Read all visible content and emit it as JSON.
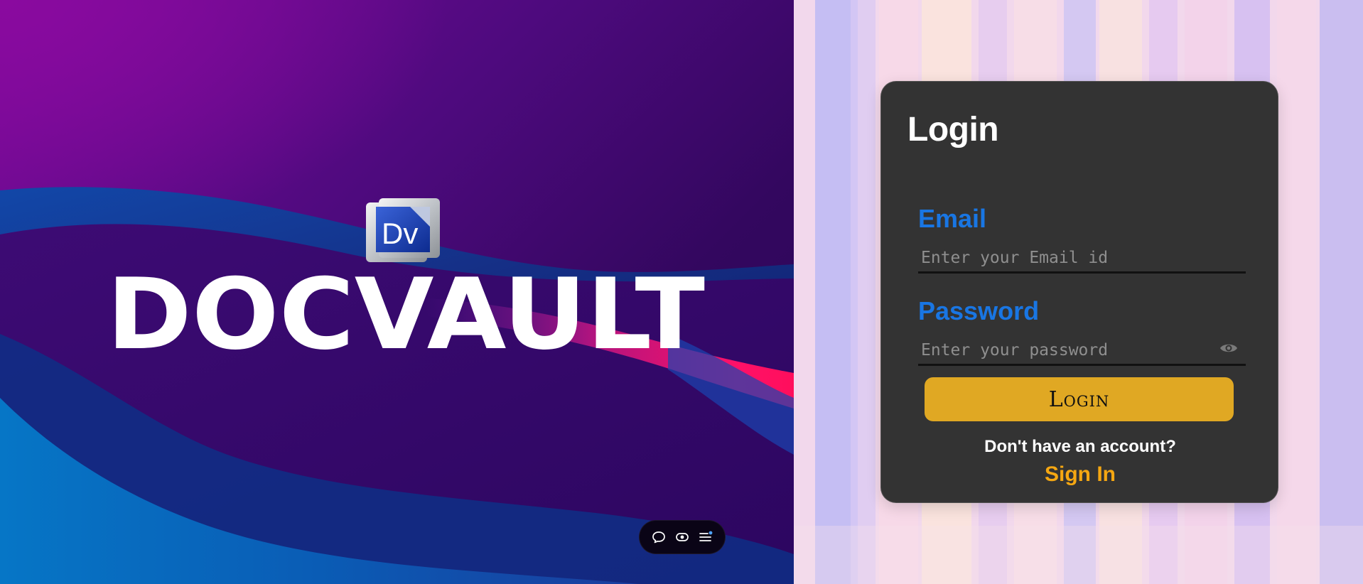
{
  "brand": {
    "name": "DocVault",
    "badge_text": "Dv"
  },
  "toolbar": {
    "items": [
      {
        "icon": "chat-bubble-icon"
      },
      {
        "icon": "eye-toggle-icon"
      },
      {
        "icon": "menu-icon"
      }
    ]
  },
  "login": {
    "title": "Login",
    "email_label": "Email",
    "email_placeholder": "Enter your Email id",
    "email_value": "",
    "password_label": "Password",
    "password_placeholder": "Enter your password",
    "password_value": "",
    "show_password_icon": "eye-icon",
    "submit_label": "Login",
    "signup_prompt": "Don't have an account?",
    "signin_link": "Sign In"
  },
  "colors": {
    "label_blue": "#1976e3",
    "button_gold": "#e0a823",
    "link_orange": "#f5a712",
    "card_bg": "#333333"
  }
}
